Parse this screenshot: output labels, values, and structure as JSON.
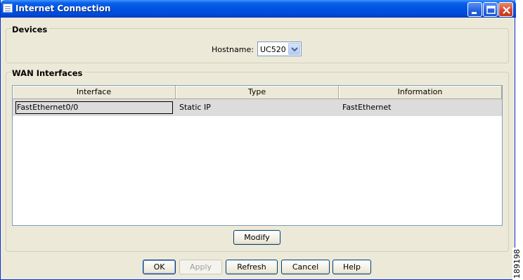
{
  "window": {
    "title": "Internet Connection"
  },
  "devices": {
    "group_label": "Devices",
    "hostname_label": "Hostname:",
    "hostname_value": "UC520"
  },
  "wan": {
    "group_label": "WAN Interfaces",
    "columns": [
      "Interface",
      "Type",
      "Information"
    ],
    "rows": [
      {
        "interface": "FastEthernet0/0",
        "type": "Static IP",
        "information": "FastEthernet"
      }
    ],
    "modify_label": "Modify"
  },
  "footer": {
    "ok_label": "OK",
    "apply_label": "Apply",
    "refresh_label": "Refresh",
    "cancel_label": "Cancel",
    "help_label": "Help"
  },
  "side_tag": "189198",
  "colors": {
    "titlebar": "#0054e3",
    "dialog_bg": "#ece9d8",
    "selected_row": "#dcdcdc"
  }
}
